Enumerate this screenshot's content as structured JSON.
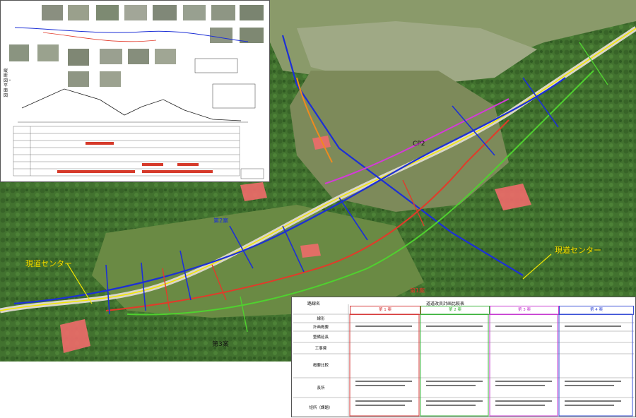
{
  "map": {
    "labels": {
      "existing_road_center_left": "現道センター",
      "existing_road_center_right": "現道センター",
      "cp2": "CP2",
      "route_2": "第2案",
      "route_1": "第1案",
      "route_3": "第3案"
    },
    "colors": {
      "route_blue": "#1c2fd6",
      "route_red": "#e23a2a",
      "route_green": "#4fd12f",
      "route_magenta": "#d43ad9",
      "route_orange": "#f08a1e",
      "existing_road_yellow": "#f2e600",
      "building_highlight": "#f06a6a"
    }
  },
  "comparison_table": {
    "header_left": "路線名",
    "header_title": "道道改良計画比較表",
    "columns": [
      "第 1 案",
      "第 2 案",
      "第 3 案",
      "第 4 案"
    ],
    "column_colors": [
      "#d63a3a",
      "#3ab23a",
      "#c63ad0",
      "#3a4fd6"
    ],
    "rows": [
      "線形",
      "計画概要",
      "整備延長",
      "工事費",
      "概要比較",
      "長所",
      "短所（課題）"
    ]
  },
  "plan_sheet": {
    "vertical_caption": "縦断図・平面図"
  }
}
